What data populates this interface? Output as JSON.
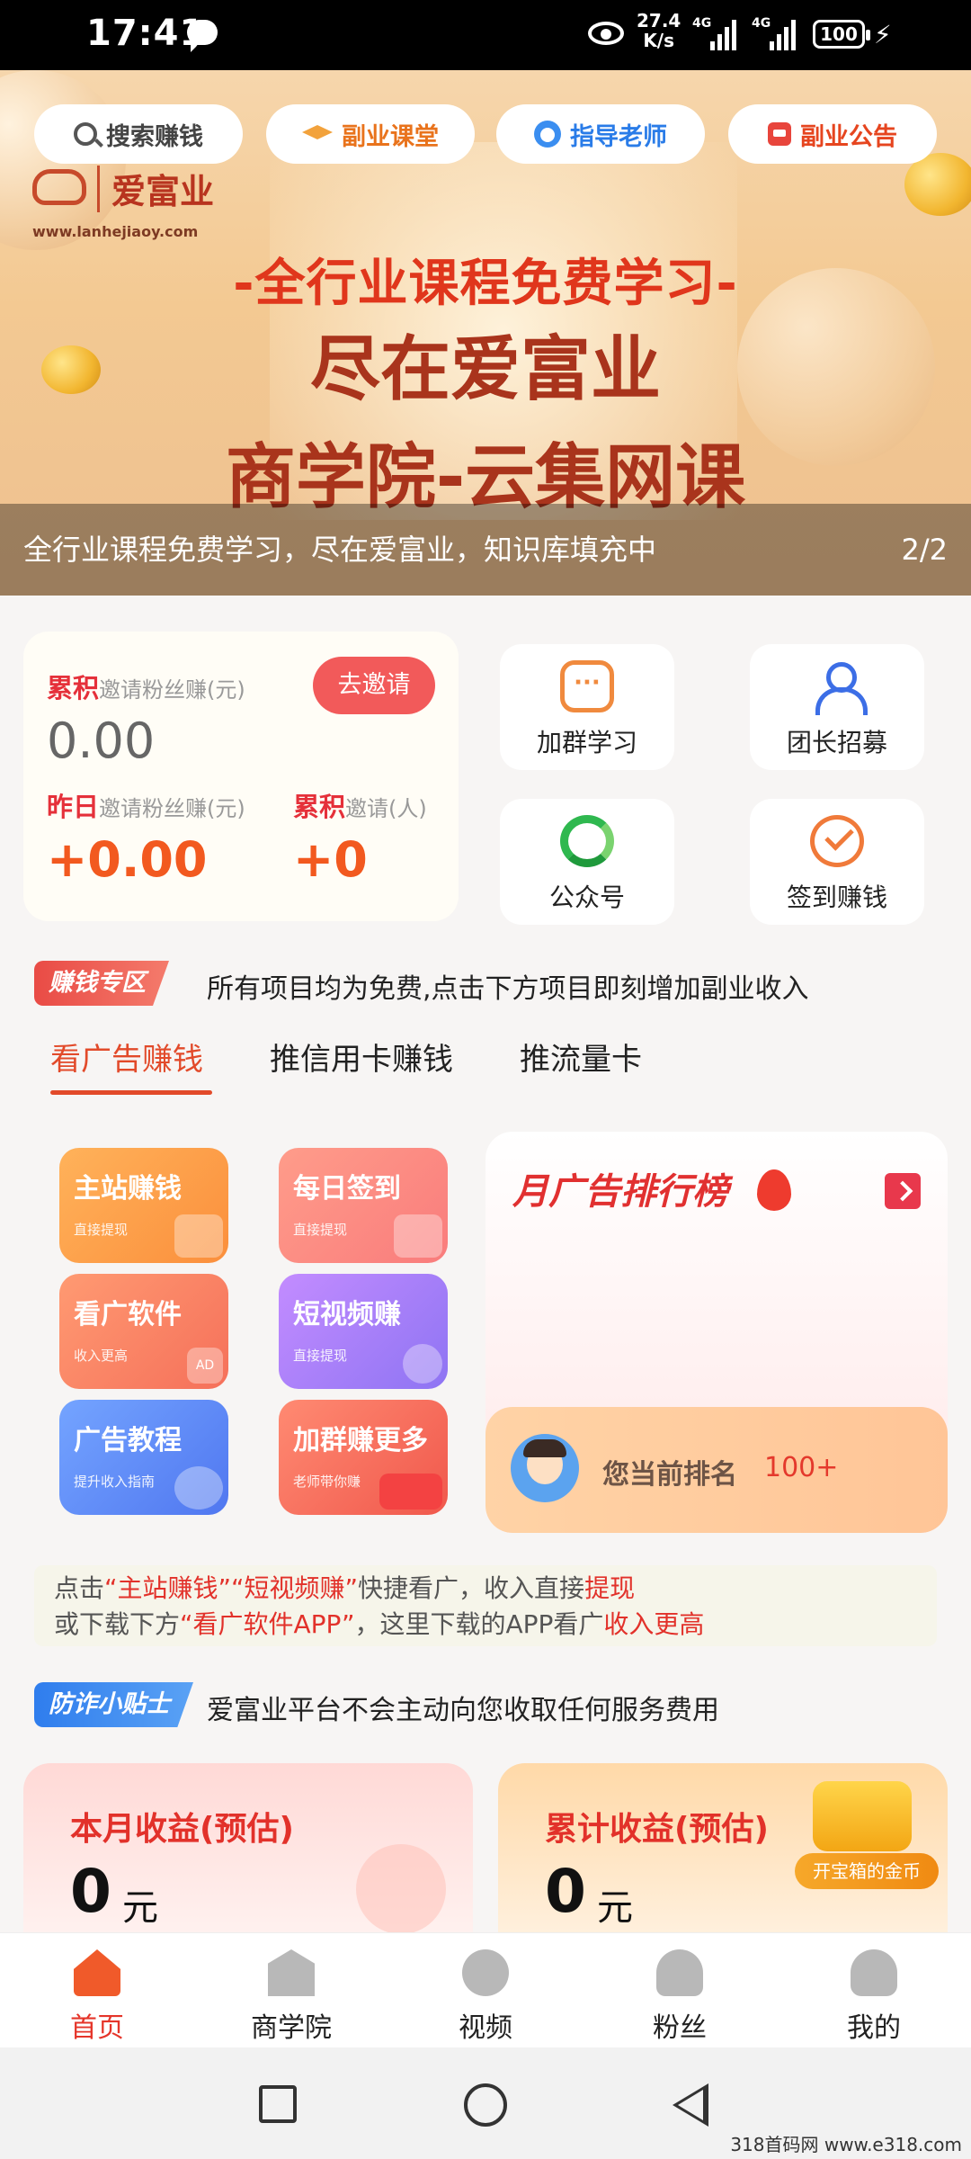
{
  "status_bar": {
    "time": "17:41",
    "speed_value": "27.4",
    "speed_unit": "K/s",
    "signal_1": "4G",
    "signal_2": "4G",
    "battery": "100"
  },
  "search_bar": {
    "search": "搜索赚钱",
    "course": "副业课堂",
    "teacher": "指导老师",
    "notice": "副业公告"
  },
  "banner": {
    "logo_name": "爱富业",
    "logo_url": "www.lanhejiaoy.com",
    "subtitle": "-全行业课程免费学习-",
    "line1": "尽在爱富业",
    "line2": "商学院-云集网课",
    "caption": "全行业课程免费学习，尽在爱富业，知识库填充中",
    "page_indicator": "2/2"
  },
  "stats": {
    "total_prefix": "累积",
    "total_label": "邀请粉丝赚(元)",
    "total_value": "0.00",
    "invite_button": "去邀请",
    "yesterday_prefix": "昨日",
    "yesterday_label": "邀请粉丝赚(元)",
    "yesterday_value": "+0.00",
    "invited_prefix": "累积",
    "invited_label": "邀请(人)",
    "invited_value": "+0"
  },
  "quick_tiles": [
    {
      "label": "加群学习",
      "icon": "chat-bubble-icon"
    },
    {
      "label": "团长招募",
      "icon": "team-icon"
    },
    {
      "label": "公众号",
      "icon": "wechat-icon"
    },
    {
      "label": "签到赚钱",
      "icon": "checkin-icon"
    }
  ],
  "earn_zone": {
    "tag": "赚钱专区",
    "text": "所有项目均为免费,点击下方项目即刻增加副业收入"
  },
  "tabs": [
    "看广告赚钱",
    "推信用卡赚钱",
    "推流量卡"
  ],
  "features": [
    {
      "title": "主站赚钱",
      "sub": "直接提现"
    },
    {
      "title": "每日签到",
      "sub": "直接提现"
    },
    {
      "title": "看广软件",
      "sub": "收入更高",
      "badge": "AD"
    },
    {
      "title": "短视频赚",
      "sub": "直接提现"
    },
    {
      "title": "广告教程",
      "sub": "提升收入指南"
    },
    {
      "title": "加群赚更多",
      "sub": "老师带你赚"
    }
  ],
  "ranking": {
    "title": "月广告排行榜",
    "my_rank_label": "您当前排名",
    "my_rank_value": "100+"
  },
  "tip": {
    "l1_a": "点击",
    "l1_b": "“主站赚钱”",
    "l1_c": "“短视频赚”",
    "l1_d": "快捷看广，收入直接",
    "l1_e": "提现",
    "l2_a": "或下载下方",
    "l2_b": "“看广软件APP”",
    "l2_c": "，这里下载的APP看广",
    "l2_d": "收入更高"
  },
  "fraud": {
    "tag": "防诈小贴士",
    "text": "爱富业平台不会主动向您收取任何服务费用"
  },
  "earnings": {
    "month_title": "本月收益(预估)",
    "month_value": "0",
    "month_unit": "元",
    "total_title": "累计收益(预估)",
    "total_value": "0",
    "total_unit": "元",
    "chest_label": "开宝箱的金币"
  },
  "bottom_nav": [
    {
      "label": "首页",
      "active": true
    },
    {
      "label": "商学院"
    },
    {
      "label": "视频"
    },
    {
      "label": "粉丝"
    },
    {
      "label": "我的"
    }
  ],
  "watermark": "318首码网  www.e318.com",
  "colors": {
    "accent": "#e5352a",
    "orange": "#f2591f",
    "blue": "#2f7ded"
  }
}
